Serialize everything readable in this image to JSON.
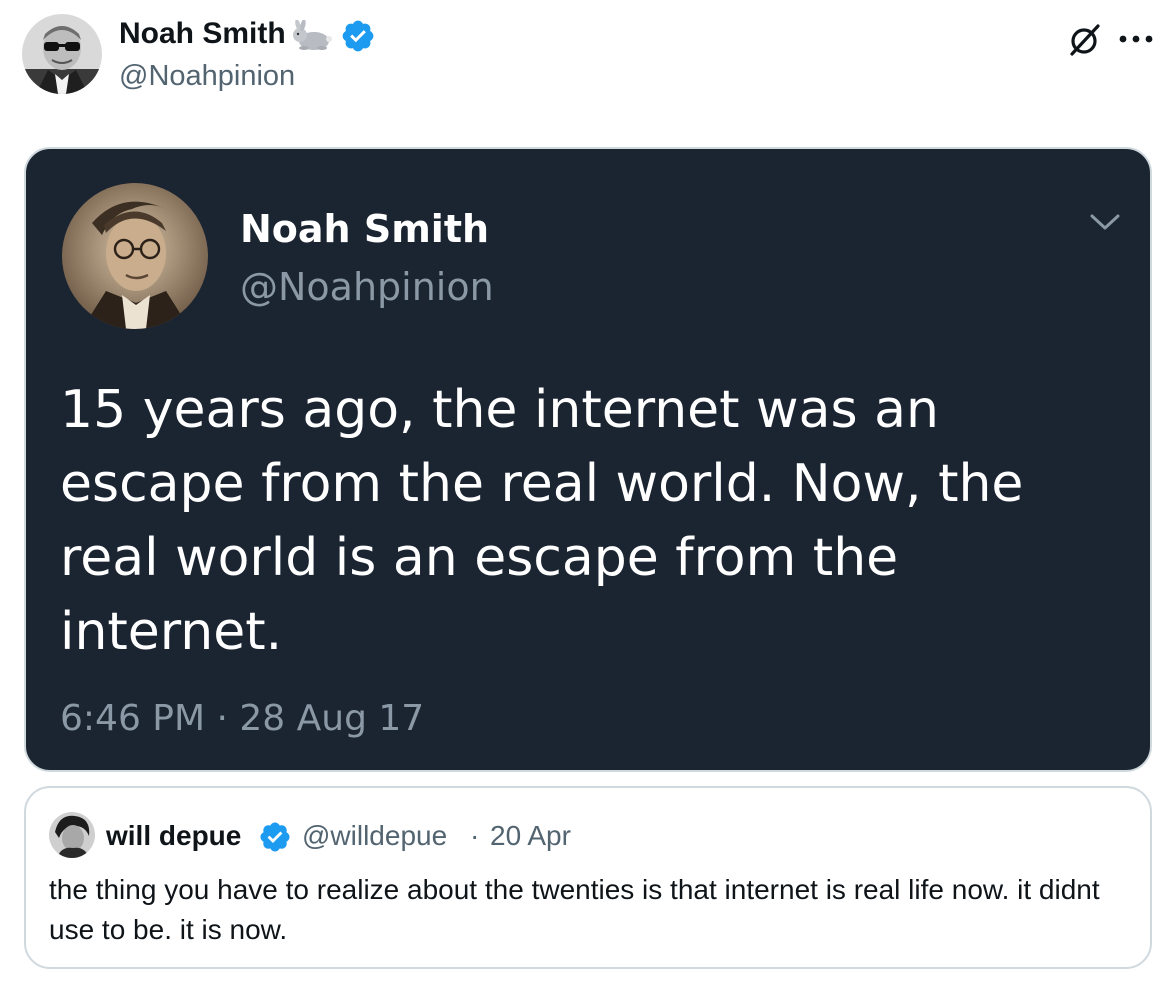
{
  "author": {
    "name": "Noah Smith",
    "handle": "@Noahpinion",
    "badge_emoji": "rabbit-icon",
    "verified_color": "#1d9bf0"
  },
  "actions": {
    "grok_icon": "grok-icon",
    "more_icon": "more-icon"
  },
  "screenshot": {
    "name": "Noah Smith",
    "handle": "@Noahpinion",
    "text": "15 years ago, the internet was an escape from the real world. Now, the real world is an escape from the internet.",
    "timestamp": "6:46 PM · 28 Aug 17",
    "background_color": "#1b2431"
  },
  "quote": {
    "name": "will depue",
    "handle": "@willdepue",
    "separator": "·",
    "date": "20 Apr",
    "text": "the thing you have to realize about the twenties is that internet is real life now. it didnt use to be. it is now."
  }
}
